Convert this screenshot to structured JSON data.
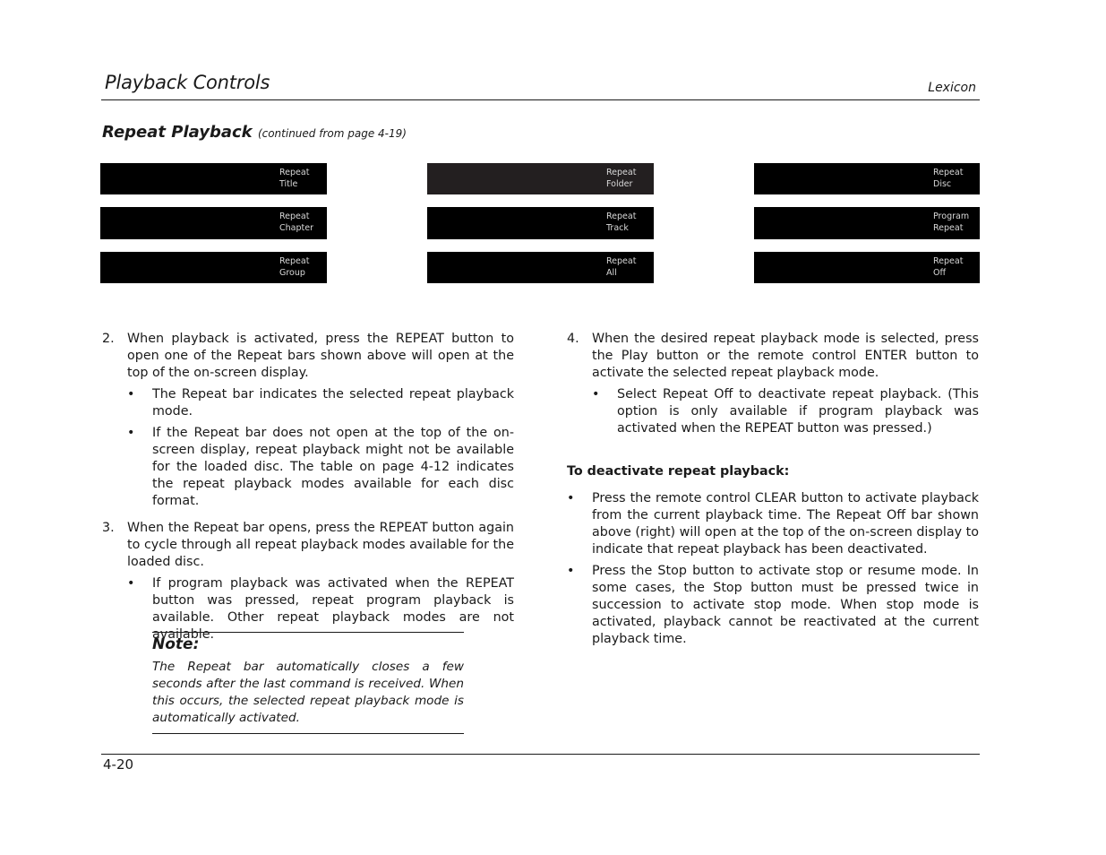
{
  "header": {
    "title": "Playback Controls",
    "brand": "Lexicon"
  },
  "section": {
    "title": "Repeat Playback",
    "subtitle": "(continued from page 4-19)"
  },
  "osd_bars": [
    {
      "line1": "Repeat",
      "line2": "Title",
      "variant": "black"
    },
    {
      "line1": "Repeat",
      "line2": "Folder",
      "variant": "dark-gray"
    },
    {
      "line1": "Repeat",
      "line2": "Disc",
      "variant": "black"
    },
    {
      "line1": "Repeat",
      "line2": "Chapter",
      "variant": "black"
    },
    {
      "line1": "Repeat",
      "line2": "Track",
      "variant": "black"
    },
    {
      "line1": "Program",
      "line2": "Repeat",
      "variant": "black"
    },
    {
      "line1": "Repeat",
      "line2": "Group",
      "variant": "black"
    },
    {
      "line1": "Repeat",
      "line2": "All",
      "variant": "black"
    },
    {
      "line1": "Repeat",
      "line2": "Off",
      "variant": "black"
    }
  ],
  "left_column": {
    "steps": [
      {
        "number": "2.",
        "text": "When playback is activated, press the REPEAT button to open one of the Repeat bars shown above will open at the top of the on-screen display.",
        "bullets": [
          "The Repeat bar indicates the selected repeat playback mode.",
          "If the Repeat bar does not open at the top of the on-screen display, repeat playback might not be available for the loaded disc. The table on page 4-12 indicates the repeat playback modes available for each disc format."
        ]
      },
      {
        "number": "3.",
        "text": "When the Repeat bar opens, press the REPEAT button again to cycle through all repeat playback modes available for the loaded disc.",
        "bullets": [
          "If program playback was activated when the REPEAT button was pressed, repeat program playback is available. Other repeat playback modes are not available."
        ]
      }
    ],
    "note": {
      "heading": "Note:",
      "body": "The Repeat bar automatically closes a few seconds after the last command is received. When this occurs, the selected repeat playback mode is automatically activated."
    }
  },
  "right_column": {
    "steps": [
      {
        "number": "4.",
        "text": "When the desired repeat playback mode is selected, press the Play button or the remote control ENTER button to activate the selected repeat playback mode.",
        "bullets": [
          "Select Repeat Off to deactivate repeat playback. (This option is only available if program playback was activated when the REPEAT button was pressed.)"
        ]
      }
    ],
    "deactivate_heading": "To deactivate repeat playback:",
    "deactivate_bullets": [
      "Press the remote control CLEAR button to activate playback from the current playback time. The Repeat Off bar shown above (right) will open at the top of the on-screen display to indicate that repeat playback has been deactivated.",
      "Press the Stop button to activate stop or resume mode. In some cases, the Stop button must be pressed twice in succession to activate stop mode. When stop mode is activated, playback cannot be reactivated at the current playback time."
    ],
    "bullet_glyph": "•"
  },
  "footer": {
    "page_number": "4-20"
  }
}
